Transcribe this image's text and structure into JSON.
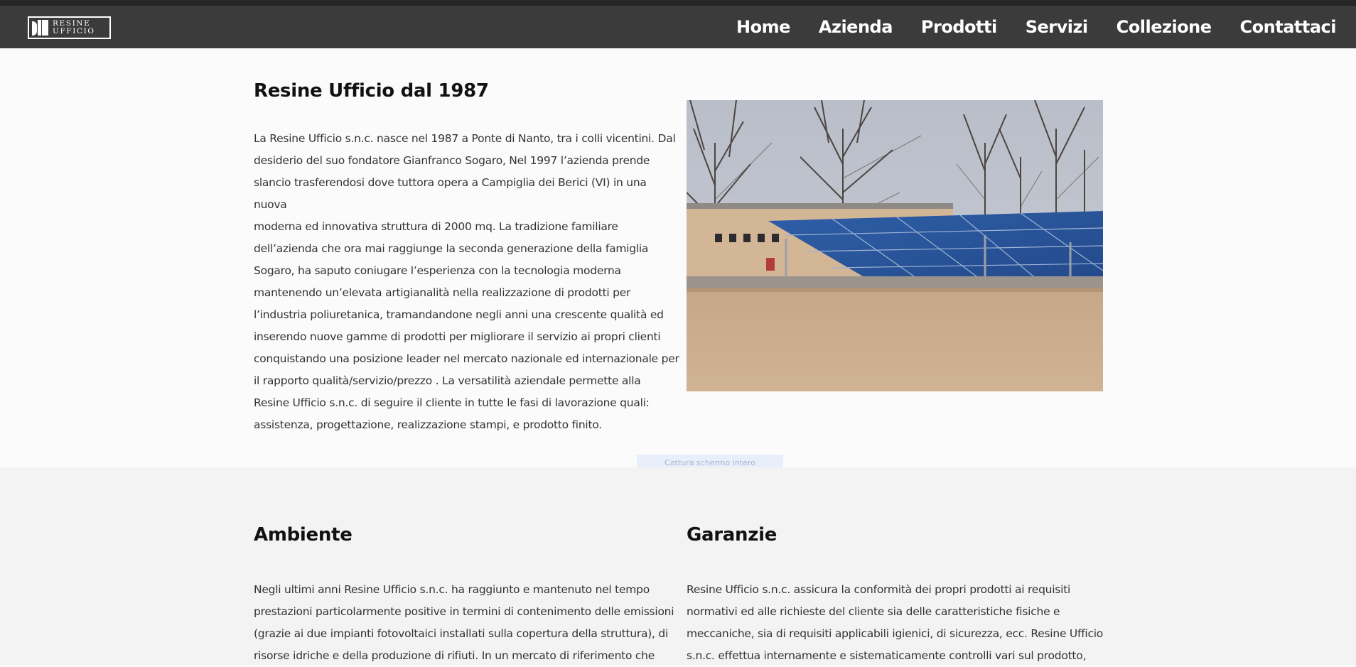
{
  "header": {
    "logo_text_line1": "RESINE",
    "logo_text_line2": "UFFICIO",
    "nav": [
      "Home",
      "Azienda",
      "Prodotti",
      "Servizi",
      "Collezione",
      "Contattaci"
    ]
  },
  "intro": {
    "title": "Resine Ufficio dal 1987",
    "lines": [
      "La Resine Ufficio s.n.c. nasce nel 1987 a Ponte di Nanto, tra i colli vicentini. Dal",
      "desiderio del suo fondatore Gianfranco Sogaro, Nel 1997 l’azienda prende",
      "slancio trasferendosi dove tuttora opera a Campiglia dei Berici (VI) in una nuova",
      "moderna ed innovativa struttura di 2000 mq. La tradizione familiare",
      "dell’azienda che ora mai raggiunge la seconda generazione della famiglia",
      "Sogaro, ha saputo coniugare l’esperienza con la tecnologia moderna",
      "mantenendo un’elevata artigianalità nella realizzazione di prodotti per",
      "l’industria poliuretanica, tramandandone negli anni una crescente qualità ed",
      "inserendo nuove gamme di prodotti per migliorare il servizio ai propri clienti",
      "conquistando una posizione leader nel mercato nazionale ed internazionale per",
      "il rapporto qualità/servizio/prezzo . La versatilità aziendale permette alla",
      "Resine Ufficio s.n.c. di seguire il cliente in tutte le fasi di lavorazione quali:",
      "assistenza, progettazione, realizzazione stampi, e prodotto finito."
    ]
  },
  "capture_label": "Cattura schermo intero",
  "ambiente": {
    "title": "Ambiente",
    "lines": [
      "Negli ultimi anni Resine Ufficio s.n.c. ha raggiunto e mantenuto nel tempo",
      "prestazioni particolarmente positive in termini di contenimento delle emissioni",
      "(grazie ai due impianti fotovoltaici installati sulla copertura della struttura), di",
      "risorse idriche e della produzione di rifiuti. In un mercato di riferimento che"
    ]
  },
  "garanzie": {
    "title": "Garanzie",
    "lines": [
      "Resine Ufficio s.n.c. assicura la conformità dei propri prodotti ai requisiti",
      "normativi ed alle richieste del cliente sia delle caratteristiche fisiche e",
      "meccaniche, sia di requisiti applicabili igienici, di sicurezza, ecc. Resine Ufficio",
      "s.n.c. effettua internamente e sistematicamente controlli vari sul prodotto,"
    ]
  }
}
